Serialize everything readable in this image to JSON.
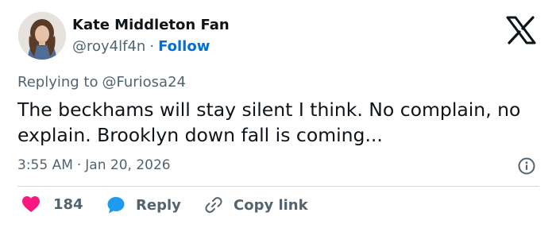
{
  "author": {
    "name": "Kate Middleton Fan",
    "handle": "@roy4lf4n",
    "separator": "·",
    "follow_label": "Follow"
  },
  "reply_context": {
    "prefix": "Replying to",
    "mention": "@Furiosa24"
  },
  "tweet": {
    "text": "The beckhams will stay silent I think. No complain, no explain. Brooklyn down fall is coming..."
  },
  "meta": {
    "time": "3:55 AM",
    "separator": "·",
    "date": "Jan 20, 2026"
  },
  "actions": {
    "likes_count": "184",
    "reply_label": "Reply",
    "copy_label": "Copy link"
  },
  "colors": {
    "like": "#f91880",
    "reply": "#1d9bf0",
    "link": "#006fd6",
    "muted": "#536471"
  },
  "icons": {
    "brand": "x-logo-icon",
    "info": "info-icon",
    "like": "heart-icon",
    "reply": "speech-bubble-icon",
    "copy": "link-icon"
  }
}
